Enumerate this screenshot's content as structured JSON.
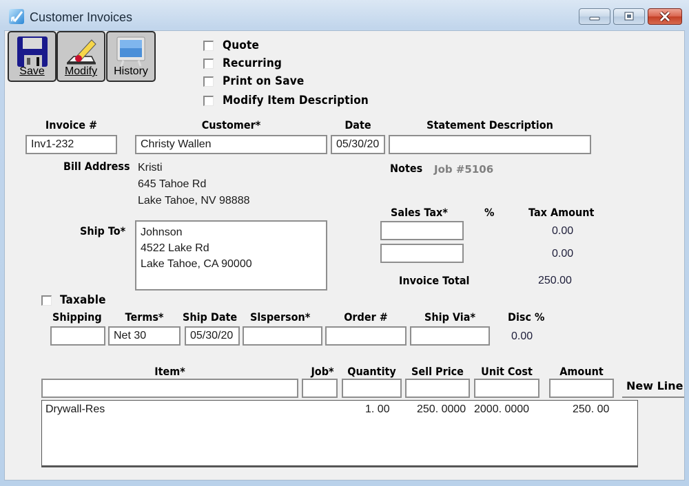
{
  "window": {
    "title": "Customer Invoices",
    "controls": {
      "minimize": "minimize",
      "maximize": "maximize",
      "close": "close"
    }
  },
  "toolbar": {
    "save": {
      "label": "Save",
      "icon": "floppy-disk-icon"
    },
    "modify": {
      "label": "Modify",
      "icon": "pencil-eraser-icon"
    },
    "history": {
      "label": "History",
      "icon": "monitor-icon"
    }
  },
  "options": [
    {
      "label": "Quote",
      "checked": false
    },
    {
      "label": "Recurring",
      "checked": false
    },
    {
      "label": "Print on Save",
      "checked": false
    },
    {
      "label": "Modify Item Description",
      "checked": false
    }
  ],
  "header": {
    "invoice_label": "Invoice #",
    "invoice_value": "Inv1-232",
    "customer_label": "Customer*",
    "customer_value": "Christy Wallen",
    "date_label": "Date",
    "date_value": "05/30/20",
    "statement_label": "Statement Description",
    "statement_value": ""
  },
  "bill_address": {
    "label": "Bill Address",
    "lines": [
      "Kristi",
      "645 Tahoe Rd",
      "Lake Tahoe, NV  98888"
    ]
  },
  "notes": {
    "label": "Notes",
    "value": "Job #5106"
  },
  "ship_to": {
    "label": "Ship To*",
    "lines": [
      "Johnson",
      "4522 Lake Rd",
      "Lake Tahoe, CA 90000"
    ]
  },
  "tax": {
    "sales_tax_label": "Sales Tax*",
    "percent_label": "%",
    "tax_amount_label": "Tax Amount",
    "rows": [
      {
        "sales_tax": "",
        "amount": "0.00"
      },
      {
        "sales_tax": "",
        "amount": "0.00"
      }
    ],
    "invoice_total_label": "Invoice Total",
    "invoice_total": "250.00"
  },
  "taxable": {
    "label": "Taxable",
    "checked": false
  },
  "shipping_row": {
    "shipping_label": "Shipping",
    "shipping_value": "",
    "terms_label": "Terms*",
    "terms_value": "Net 30",
    "ship_date_label": "Ship Date",
    "ship_date_value": "05/30/20",
    "slsperson_label": "Slsperson*",
    "slsperson_value": "",
    "order_label": "Order #",
    "order_value": "",
    "ship_via_label": "Ship Via*",
    "ship_via_value": "",
    "disc_label": "Disc %",
    "disc_value": "0.00"
  },
  "line_entry": {
    "item_label": "Item*",
    "job_label": "Job*",
    "quantity_label": "Quantity",
    "sell_price_label": "Sell Price",
    "unit_cost_label": "Unit Cost",
    "amount_label": "Amount",
    "new_line_label": "New Line"
  },
  "lines": [
    {
      "item": "Drywall-Res",
      "quantity": "1. 00",
      "sell_price": "250. 0000",
      "unit_cost": "2000. 0000",
      "amount": "250. 00"
    }
  ]
}
